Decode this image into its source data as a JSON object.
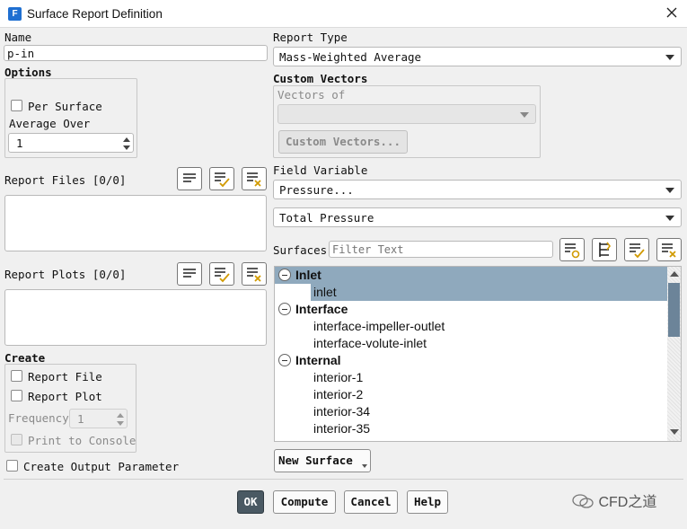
{
  "window": {
    "title": "Surface Report Definition",
    "app_icon_letter": "F"
  },
  "name": {
    "label": "Name",
    "value": "p-in"
  },
  "options": {
    "label": "Options",
    "per_surface_label": "Per Surface",
    "average_over_label": "Average Over",
    "average_over_value": "1"
  },
  "report_files": {
    "label": "Report Files [0/0]"
  },
  "report_plots": {
    "label": "Report Plots [0/0]"
  },
  "create": {
    "label": "Create",
    "report_file_label": "Report File",
    "report_plot_label": "Report Plot",
    "frequency_label": "Frequency",
    "frequency_value": "1",
    "print_to_console_label": "Print to Console"
  },
  "create_output_parameter_label": "Create Output Parameter",
  "report_type": {
    "label": "Report Type",
    "value": "Mass-Weighted Average"
  },
  "custom_vectors": {
    "label": "Custom Vectors",
    "vectors_of_label": "Vectors of",
    "vectors_of_value": "",
    "button_label": "Custom Vectors..."
  },
  "field_variable": {
    "label": "Field Variable",
    "category_value": "Pressure...",
    "variable_value": "Total Pressure"
  },
  "surfaces": {
    "label": "Surfaces",
    "filter_placeholder": "Filter Text",
    "tree": [
      {
        "type": "group",
        "label": "Inlet",
        "selected": true
      },
      {
        "type": "item",
        "label": "inlet",
        "selected": true
      },
      {
        "type": "group",
        "label": "Interface",
        "selected": false
      },
      {
        "type": "item",
        "label": "interface-impeller-outlet",
        "selected": false
      },
      {
        "type": "item",
        "label": "interface-volute-inlet",
        "selected": false
      },
      {
        "type": "group",
        "label": "Internal",
        "selected": false
      },
      {
        "type": "item",
        "label": "interior-1",
        "selected": false
      },
      {
        "type": "item",
        "label": "interior-2",
        "selected": false
      },
      {
        "type": "item",
        "label": "interior-34",
        "selected": false
      },
      {
        "type": "item",
        "label": "interior-35",
        "selected": false
      }
    ]
  },
  "new_surface_label": "New Surface",
  "buttons": {
    "ok": "OK",
    "compute": "Compute",
    "cancel": "Cancel",
    "help": "Help"
  },
  "watermark": "CFD之道",
  "colors": {
    "selection": "#8fa9bd",
    "primary_button": "#4a5963",
    "scroll_thumb": "#6c8499",
    "app_icon": "#1f6fd1"
  }
}
